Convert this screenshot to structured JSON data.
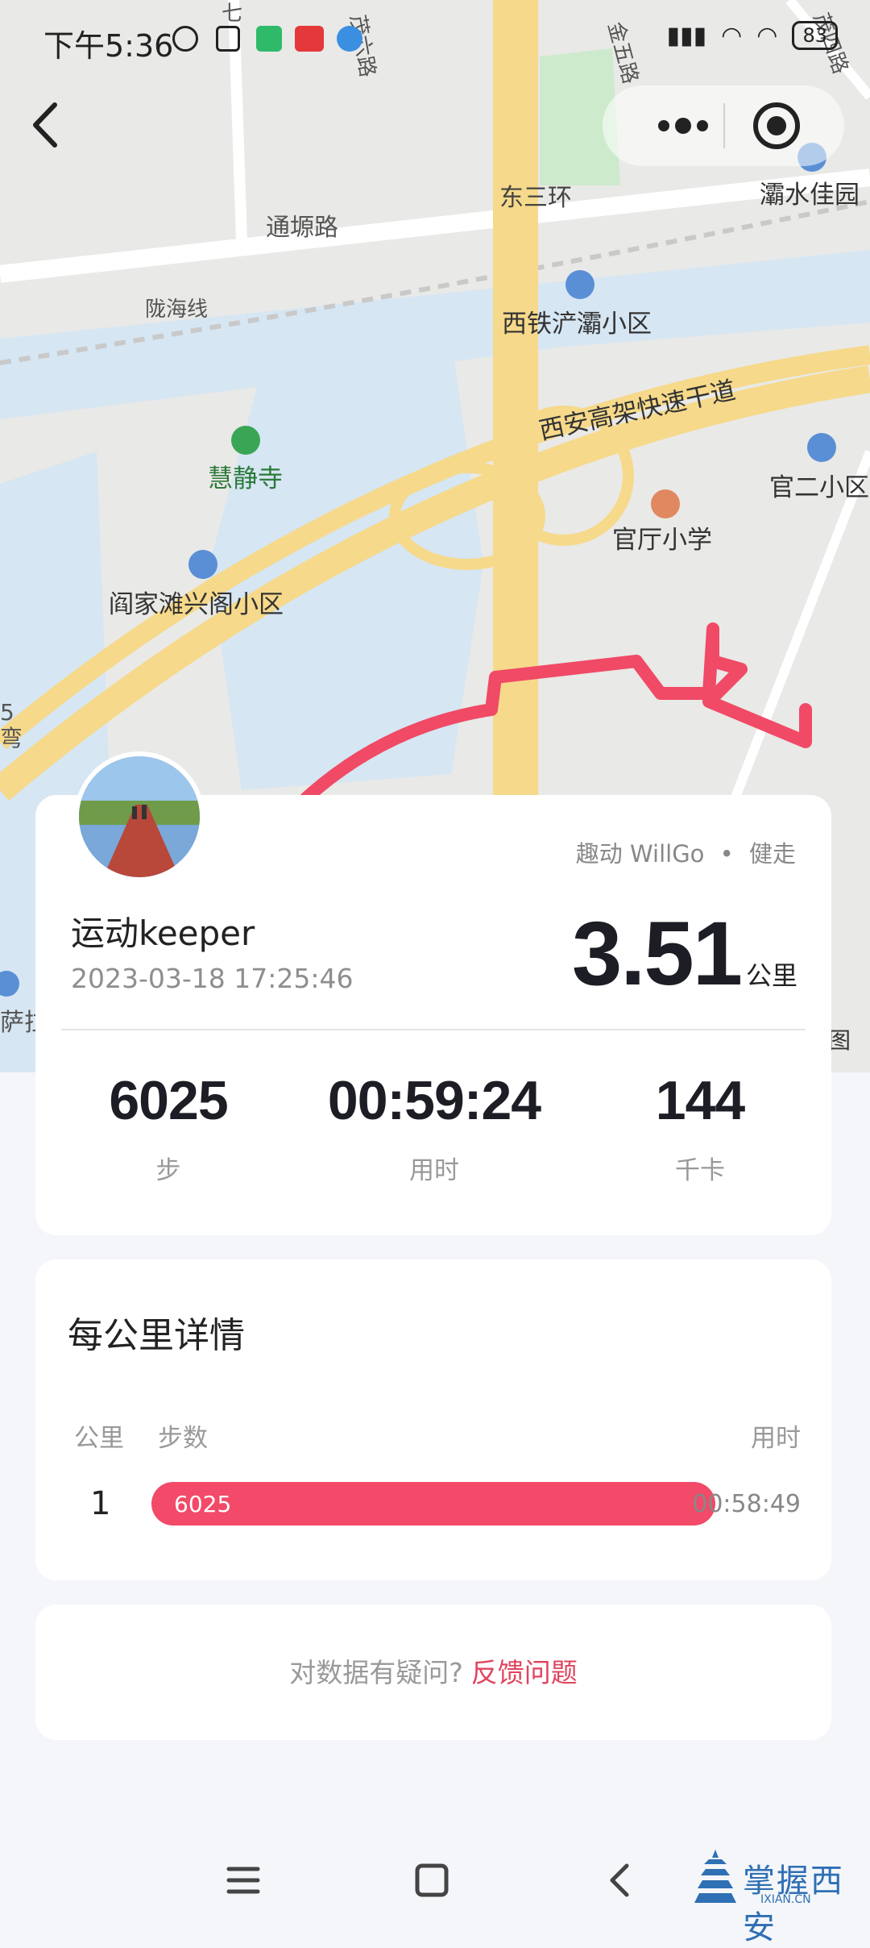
{
  "status_bar": {
    "time": "下午5:36",
    "battery": "83"
  },
  "map": {
    "labels": {
      "road_tongba": "通塬路",
      "rail_longhai": "陇海线",
      "ring_east3": "东三环",
      "area_xitie": "西铁浐灞小区",
      "expressway": "西安高架快速干道",
      "temple": "慧静寺",
      "area_yanjia": "阎家滩兴阁小区",
      "school": "官厅小学",
      "area_guaner": "官二小区",
      "area_bashui": "灞水佳园",
      "road_mao4": "茂四路",
      "road_jin5": "金五路",
      "road_mao6": "茂六路",
      "road_7": "七",
      "edge_left": "5",
      "edge_left2": "弯",
      "edge_sa": "萨拉",
      "edge_tu": "图"
    },
    "colors": {
      "land": "#e8e8e6",
      "water": "#d6e6f3",
      "green": "#cdeacd",
      "highway": "#f6d98a",
      "route": "#f04a66"
    }
  },
  "summary": {
    "app_source": "趣动 WillGo",
    "activity_type": "健走",
    "separator": "•",
    "username": "运动keeper",
    "datetime": "2023-03-18 17:25:46",
    "distance": "3.51",
    "distance_unit": "公里",
    "stats": [
      {
        "value": "6025",
        "label": "步"
      },
      {
        "value": "00:59:24",
        "label": "用时"
      },
      {
        "value": "144",
        "label": "千卡"
      }
    ]
  },
  "km_details": {
    "title": "每公里详情",
    "headers": {
      "km": "公里",
      "steps": "步数",
      "time": "用时"
    },
    "rows": [
      {
        "km": "1",
        "steps": "6025",
        "time": "00:58:49",
        "fill": 1.0
      }
    ]
  },
  "feedback": {
    "question": "对数据有疑问?",
    "link": "反馈问题"
  },
  "watermark": {
    "text": "掌握西安",
    "url": "IXIAN.CN"
  }
}
